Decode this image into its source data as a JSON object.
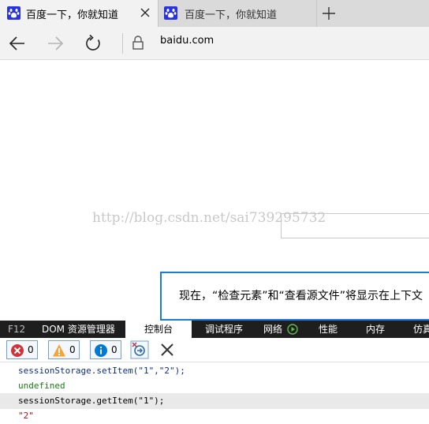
{
  "tabs": [
    {
      "title": "百度一下，你就知道",
      "active": true
    },
    {
      "title": "百度一下，你就知道",
      "active": false
    }
  ],
  "icons": {
    "favicon": "baidu-paw-icon",
    "close": "close-icon",
    "new_tab": "plus-icon",
    "back": "arrow-left-icon",
    "forward": "arrow-right-icon",
    "refresh": "refresh-icon",
    "lock": "lock-icon",
    "play": "play-icon",
    "error": "error-icon",
    "warning": "warning-icon",
    "info": "info-icon",
    "clear_on_navigate": "clear-on-navigate-icon",
    "clear": "clear-icon"
  },
  "colors": {
    "accent_blue": "#2932e1",
    "devtools_dark": "#1e1e1e",
    "notice_border": "#1e7ad4",
    "error_red": "#d13438",
    "warning_orange": "#f7a336",
    "info_blue": "#0078d7",
    "play_green": "#5fbb4d"
  },
  "navbar": {
    "address": "baidu.com"
  },
  "page": {
    "watermark": "http://blog.csdn.net/sai739295732",
    "notice_text": "现在，“检查元素”和“查看源文件”将显示在上下文"
  },
  "devtools": {
    "tabs": [
      {
        "label": "F12"
      },
      {
        "label": "DOM 资源管理器"
      },
      {
        "label": "控制台",
        "active": true
      },
      {
        "label": "调试程序"
      },
      {
        "label": "网络"
      },
      {
        "label": "性能"
      },
      {
        "label": "内存"
      },
      {
        "label": "仿真"
      }
    ],
    "filters": {
      "errors": "0",
      "warnings": "0",
      "messages": "0"
    },
    "console_lines": [
      "sessionStorage.setItem(\"1\",\"2\");",
      "undefined",
      "sessionStorage.getItem(\"1\");",
      "\"2\""
    ]
  }
}
